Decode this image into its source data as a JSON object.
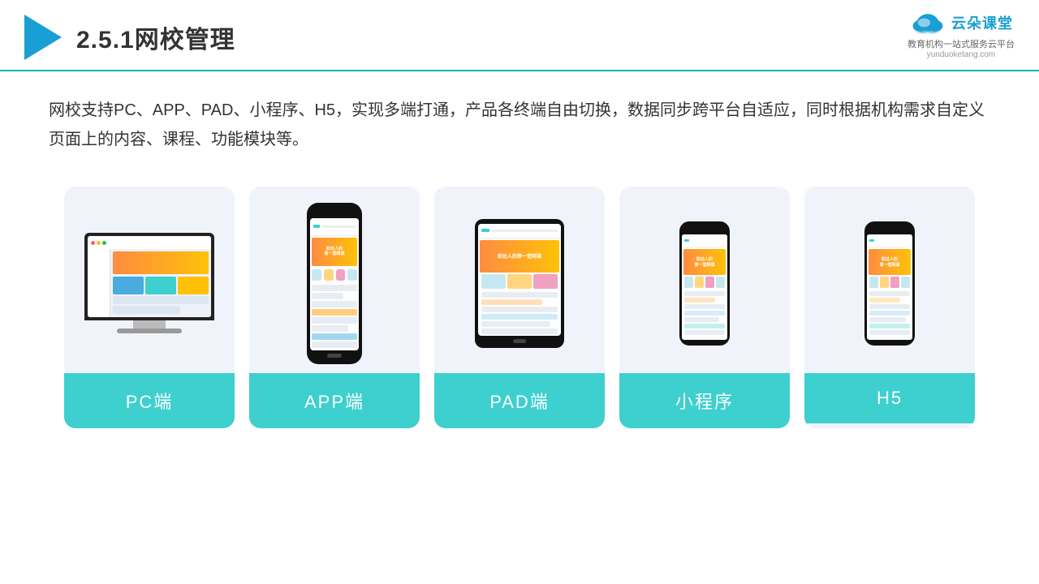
{
  "header": {
    "title": "2.5.1网校管理",
    "title_num": "2.5.1",
    "title_text": "网校管理"
  },
  "brand": {
    "name": "云朵课堂",
    "tagline": "教育机构一站\n式服务云平台",
    "url": "yunduoketang.com"
  },
  "description": {
    "text": "网校支持PC、APP、PAD、小程序、H5，实现多端打通，产品各终端自由切换，数据同步跨平台自适应，同时根据机构需求自定义页面上的内容、课程、功能模块等。"
  },
  "cards": [
    {
      "id": "pc",
      "label": "PC端",
      "type": "pc"
    },
    {
      "id": "app",
      "label": "APP端",
      "type": "phone"
    },
    {
      "id": "pad",
      "label": "PAD端",
      "type": "tablet"
    },
    {
      "id": "miniapp",
      "label": "小程序",
      "type": "phone2"
    },
    {
      "id": "h5",
      "label": "H5",
      "type": "phone3"
    }
  ],
  "colors": {
    "accent": "#3ecfcf",
    "header_line": "#00b4b4",
    "arrow": "#1a9fd4",
    "text_dark": "#333",
    "card_bg": "#f0f4fa"
  }
}
